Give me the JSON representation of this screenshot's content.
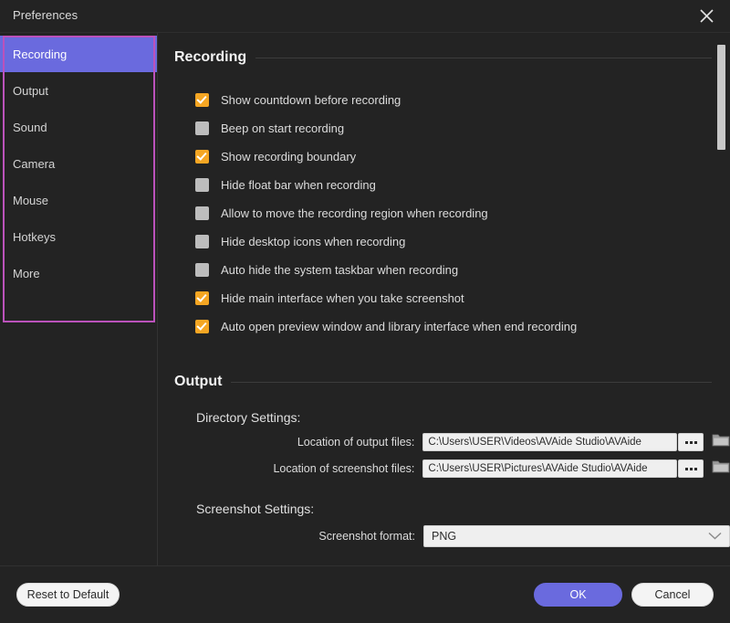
{
  "window": {
    "title": "Preferences",
    "close_icon": "close-icon"
  },
  "sidebar": {
    "items": [
      {
        "label": "Recording",
        "active": true
      },
      {
        "label": "Output",
        "active": false
      },
      {
        "label": "Sound",
        "active": false
      },
      {
        "label": "Camera",
        "active": false
      },
      {
        "label": "Mouse",
        "active": false
      },
      {
        "label": "Hotkeys",
        "active": false
      },
      {
        "label": "More",
        "active": false
      }
    ],
    "highlight_color": "#bb52bb",
    "active_color": "#6a6ade"
  },
  "main": {
    "recording_section": {
      "heading": "Recording",
      "checkboxes": [
        {
          "label": "Show countdown before recording",
          "checked": true
        },
        {
          "label": "Beep on start recording",
          "checked": false
        },
        {
          "label": "Show recording boundary",
          "checked": true
        },
        {
          "label": "Hide float bar when recording",
          "checked": false
        },
        {
          "label": "Allow to move the recording region when recording",
          "checked": false
        },
        {
          "label": "Hide desktop icons when recording",
          "checked": false
        },
        {
          "label": "Auto hide the system taskbar when recording",
          "checked": false
        },
        {
          "label": "Hide main interface when you take screenshot",
          "checked": true
        },
        {
          "label": "Auto open preview window and library interface when end recording",
          "checked": true
        }
      ],
      "checked_color": "#f5a623"
    },
    "output_section": {
      "heading": "Output",
      "directory_settings_label": "Directory Settings:",
      "fields": [
        {
          "label": "Location of output files:",
          "value": "C:\\Users\\USER\\Videos\\AVAide Studio\\AVAide",
          "browse_label": "...",
          "folder_icon": "folder-icon"
        },
        {
          "label": "Location of screenshot files:",
          "value": "C:\\Users\\USER\\Pictures\\AVAide Studio\\AVAide",
          "browse_label": "...",
          "folder_icon": "folder-icon"
        }
      ],
      "screenshot_settings_label": "Screenshot Settings:",
      "screenshot_format": {
        "label": "Screenshot format:",
        "value": "PNG",
        "chevron_icon": "chevron-down-icon"
      }
    }
  },
  "footer": {
    "reset_label": "Reset to Default",
    "ok_label": "OK",
    "cancel_label": "Cancel",
    "ok_color": "#6a6ade"
  }
}
